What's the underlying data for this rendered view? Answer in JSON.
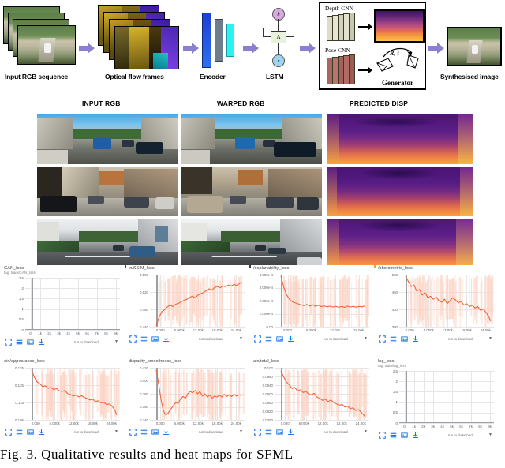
{
  "figure": {
    "caption": "Fig. 3.  Qualitative results and heat maps for SFML"
  },
  "architecture": {
    "stages": [
      {
        "id": "input-rgb",
        "label": "Input RGB sequence"
      },
      {
        "id": "optical-flow",
        "label": "Optical flow frames"
      },
      {
        "id": "encoder",
        "label": "Encoder"
      },
      {
        "id": "lstm",
        "label": "LSTM"
      },
      {
        "id": "synthesised",
        "label": "Synthesised image"
      }
    ],
    "lstm_nodes": {
      "hidden": "h",
      "cell": "A",
      "input": "x"
    },
    "generator_panel": {
      "depth_cnn_label": "Depth CNN",
      "pose_cnn_label": "Pose CNN",
      "transform_label": "R, t",
      "generator_label": "Generator"
    }
  },
  "grid": {
    "columns": [
      "INPUT RGB",
      "WARPED RGB",
      "PREDICTED DISP"
    ],
    "rows": 3
  },
  "tensorboard": {
    "accent_line": "#f4633a",
    "accent_band": "#fbd5c6",
    "icon_color": "#1a73e8",
    "download_label": "run to download",
    "toolbar_icons": [
      "fullscreen-icon",
      "lines-icon",
      "fit-icon",
      "download-icon"
    ],
    "charts": [
      {
        "id": "gan-loss",
        "title": "GAN_loss",
        "tag": "tag: train/GAN_loss",
        "yticks": [
          "0",
          "0.5",
          "1",
          "1.5",
          "2",
          "2.5"
        ],
        "xticks": [
          "0",
          "1k",
          "2k",
          "3k",
          "4k",
          "5k",
          "6k",
          "7k",
          "8k",
          "9k"
        ],
        "empty": true
      },
      {
        "id": "ssim-loss",
        "title": "in/SSIM_loss",
        "tag": "",
        "yticks": [
          "0.440",
          "0.480",
          "0.520",
          "0.560"
        ],
        "xticks": [
          "0.000",
          "6.000k",
          "12.00k",
          "18.00k",
          "24.00k"
        ],
        "empty": false
      },
      {
        "id": "explanability-loss",
        "title": "/explanability_loss",
        "tag": "",
        "yticks": [
          "0.00",
          "1.000e-4",
          "2.000e-4",
          "3.000e-4",
          "4.000e-4"
        ],
        "xticks": [
          "0.000",
          "6.000k",
          "12.00k",
          "18.00k"
        ],
        "empty": false
      },
      {
        "id": "photometric-loss",
        "title": "/photometric_loss",
        "tag": "",
        "yticks": [
          "380",
          "420",
          "460",
          "500"
        ],
        "xticks": [
          "0.000",
          "6.000k",
          "12.00k",
          "18.00k",
          "24.00k"
        ],
        "empty": false
      },
      {
        "id": "appearance-loss",
        "title": "ain/appearance_loss",
        "tag": "",
        "yticks": [
          "0.105",
          "0.115",
          "0.125",
          "0.135"
        ],
        "xticks": [
          "0.000",
          "6.000k",
          "12.00k",
          "18.00k",
          "24.00k"
        ],
        "empty": false
      },
      {
        "id": "disparity-smoothness-loss",
        "title": "disparity_smoothness_loss",
        "tag": "",
        "yticks": [
          "0.340",
          "0.360",
          "0.380",
          "0.400",
          "0.420"
        ],
        "xticks": [
          "0.000",
          "6.000k",
          "12.00k",
          "18.00k",
          "24.00k"
        ],
        "empty": false
      },
      {
        "id": "total-loss",
        "title": "ain/total_loss",
        "tag": "",
        "yticks": [
          "0.0780",
          "0.0820",
          "0.0860",
          "0.0900",
          "0.0940",
          "0.0980",
          "0.102"
        ],
        "xticks": [
          "0.000",
          "6.000k",
          "12.00k",
          "18.00k",
          "24.00k"
        ],
        "empty": false
      },
      {
        "id": "lng-loss",
        "title": "lng_loss",
        "tag": "tag: train/lng_loss",
        "yticks": [
          "0",
          "0.5",
          "1",
          "1.5",
          "2",
          "2.5"
        ],
        "xticks": [
          "0",
          "1k",
          "2k",
          "3k",
          "4k",
          "5k",
          "6k",
          "7k",
          "8k",
          "9k"
        ],
        "empty": true
      }
    ]
  },
  "chart_data": [
    {
      "type": "line",
      "id": "gan-loss",
      "title": "GAN_loss",
      "subtitle": "tag: train/GAN_loss",
      "xlabel": "",
      "ylabel": "",
      "ylim": [
        0,
        2.8
      ],
      "xlim": [
        0,
        9500
      ],
      "grid": true,
      "legend": "none",
      "series": [
        {
          "name": "train/GAN_loss",
          "x": [],
          "values": []
        }
      ],
      "note": "flat at 0 / no data drawn"
    },
    {
      "type": "line",
      "id": "ssim-loss",
      "title": "in/SSIM_loss",
      "xlabel": "",
      "ylabel": "",
      "ylim": [
        0.425,
        0.575
      ],
      "xlim": [
        0,
        25000
      ],
      "grid": true,
      "legend": "none",
      "series": [
        {
          "name": "train/SSIM_loss",
          "x": [
            0,
            800,
            1600,
            2400,
            3200,
            4000,
            4800,
            5600,
            6400,
            7200,
            8000,
            8800,
            9600,
            10400,
            11200,
            12000,
            12800,
            13600,
            14400,
            15200,
            16000,
            16800,
            17600,
            18400,
            19200,
            20000,
            20800,
            21600,
            22400,
            23200,
            24000,
            24600
          ],
          "values": [
            0.428,
            0.452,
            0.468,
            0.474,
            0.482,
            0.487,
            0.483,
            0.49,
            0.492,
            0.497,
            0.501,
            0.504,
            0.509,
            0.513,
            0.508,
            0.516,
            0.52,
            0.523,
            0.529,
            0.534,
            0.53,
            0.538,
            0.541,
            0.537,
            0.543,
            0.54,
            0.545,
            0.542,
            0.547,
            0.544,
            0.549,
            0.554
          ]
        }
      ],
      "band": "shaded variance band, same colour, light"
    },
    {
      "type": "line",
      "id": "explanability-loss",
      "title": "/explanability_loss",
      "xlabel": "",
      "ylabel": "",
      "ylim": [
        0,
        0.00045
      ],
      "xlim": [
        0,
        21000
      ],
      "grid": true,
      "legend": "none",
      "series": [
        {
          "name": "train/explanability_loss",
          "x": [
            0,
            700,
            1400,
            2100,
            2800,
            3500,
            4200,
            4900,
            5600,
            6300,
            7000,
            7700,
            8400,
            9100,
            9800,
            10500,
            11200,
            11900,
            12600,
            13300,
            14000,
            14700,
            15400,
            16100,
            16800,
            17500,
            18200,
            18900,
            19600,
            20300
          ],
          "values": [
            0.00044,
            0.00034,
            0.000275,
            0.000235,
            0.000215,
            0.000205,
            0.000198,
            0.000188,
            0.000182,
            0.000192,
            0.000178,
            0.00019,
            0.000176,
            0.000186,
            0.000174,
            0.00018,
            0.000172,
            0.000178,
            0.00017,
            0.000176,
            0.000168,
            0.000175,
            0.000167,
            0.000178,
            0.00017,
            0.000176,
            0.000169,
            0.000175,
            0.000172,
            0.00018
          ]
        }
      ]
    },
    {
      "type": "line",
      "id": "photometric-loss",
      "title": "/photometric_loss",
      "xlabel": "",
      "ylabel": "",
      "ylim": [
        370,
        510
      ],
      "xlim": [
        0,
        25000
      ],
      "grid": true,
      "legend": "none",
      "series": [
        {
          "name": "train/photometric_loss",
          "x": [
            0,
            800,
            1600,
            2400,
            3200,
            4000,
            4800,
            5600,
            6400,
            7200,
            8000,
            8800,
            9600,
            10400,
            11200,
            12000,
            12800,
            13600,
            14400,
            15200,
            16000,
            16800,
            17600,
            18400,
            19200,
            20000,
            20800,
            21600,
            22400,
            23200,
            24000,
            24500
          ],
          "values": [
            505,
            492,
            478,
            482,
            466,
            470,
            455,
            462,
            448,
            452,
            444,
            450,
            440,
            436,
            444,
            432,
            440,
            448,
            442,
            434,
            438,
            428,
            432,
            424,
            428,
            420,
            424,
            414,
            418,
            408,
            396,
            385
          ]
        }
      ]
    },
    {
      "type": "line",
      "id": "appearance-loss",
      "title": "ain/appearance_loss",
      "xlabel": "",
      "ylabel": "",
      "ylim": [
        0.1018,
        0.1385
      ],
      "xlim": [
        0,
        25000
      ],
      "grid": true,
      "legend": "none",
      "series": [
        {
          "name": "train/appearance_loss",
          "x": [
            0,
            800,
            1600,
            2400,
            3200,
            4000,
            4800,
            5600,
            6400,
            7200,
            8000,
            8800,
            9600,
            10400,
            11200,
            12000,
            12800,
            13600,
            14400,
            15200,
            16000,
            16800,
            17600,
            18400,
            19200,
            20000,
            20800,
            21600,
            22400,
            23200,
            24000,
            24500
          ],
          "values": [
            0.137,
            0.1318,
            0.1286,
            0.1272,
            0.1252,
            0.1258,
            0.124,
            0.1246,
            0.1232,
            0.1238,
            0.1222,
            0.1218,
            0.1226,
            0.1202,
            0.1196,
            0.1186,
            0.1192,
            0.118,
            0.1188,
            0.1176,
            0.1168,
            0.1158,
            0.1164,
            0.1148,
            0.1152,
            0.1138,
            0.1142,
            0.1126,
            0.113,
            0.1114,
            0.1086,
            0.1052
          ]
        }
      ]
    },
    {
      "type": "line",
      "id": "disparity-smoothness-loss",
      "title": "disparity_smoothness_loss",
      "xlabel": "",
      "ylabel": "",
      "ylim": [
        0.332,
        0.428
      ],
      "xlim": [
        0,
        25000
      ],
      "grid": true,
      "legend": "none",
      "series": [
        {
          "name": "train/disparity_smoothness_loss",
          "x": [
            0,
            700,
            1400,
            2100,
            2800,
            3500,
            4200,
            4900,
            5600,
            6300,
            7000,
            7700,
            8400,
            9100,
            9800,
            10500,
            11200,
            11900,
            12600,
            13300,
            14000,
            14700,
            15400,
            16100,
            16800,
            17500,
            18200,
            18900,
            19600,
            20300,
            21000,
            21700,
            22400,
            23100,
            23800,
            24400
          ],
          "values": [
            0.424,
            0.398,
            0.368,
            0.348,
            0.341,
            0.345,
            0.352,
            0.358,
            0.364,
            0.362,
            0.37,
            0.375,
            0.372,
            0.38,
            0.384,
            0.382,
            0.386,
            0.38,
            0.384,
            0.376,
            0.38,
            0.374,
            0.378,
            0.372,
            0.376,
            0.374,
            0.378,
            0.374,
            0.379,
            0.375,
            0.378,
            0.375,
            0.379,
            0.376,
            0.378,
            0.377
          ]
        }
      ]
    },
    {
      "type": "line",
      "id": "total-loss",
      "title": "ain/total_loss",
      "xlabel": "",
      "ylabel": "",
      "ylim": [
        0.0768,
        0.1035
      ],
      "xlim": [
        0,
        25000
      ],
      "grid": true,
      "legend": "none",
      "series": [
        {
          "name": "train/total_loss",
          "x": [
            0,
            800,
            1600,
            2400,
            3200,
            4000,
            4800,
            5600,
            6400,
            7200,
            8000,
            8800,
            9600,
            10400,
            11200,
            12000,
            12800,
            13600,
            14400,
            15200,
            16000,
            16800,
            17600,
            18400,
            19200,
            20000,
            20800,
            21600,
            22400,
            23200,
            24000,
            24500
          ],
          "values": [
            0.102,
            0.0988,
            0.0962,
            0.0948,
            0.0928,
            0.0934,
            0.0916,
            0.0922,
            0.0908,
            0.0914,
            0.09,
            0.0896,
            0.0904,
            0.0884,
            0.0878,
            0.0868,
            0.0874,
            0.0862,
            0.087,
            0.0858,
            0.085,
            0.0842,
            0.0848,
            0.0834,
            0.0838,
            0.0826,
            0.083,
            0.0816,
            0.082,
            0.0806,
            0.079,
            0.078
          ]
        }
      ]
    },
    {
      "type": "line",
      "id": "lng-loss",
      "title": "lng_loss",
      "subtitle": "tag: train/lng_loss",
      "xlabel": "",
      "ylabel": "",
      "ylim": [
        0,
        2.8
      ],
      "xlim": [
        0,
        9500
      ],
      "grid": true,
      "legend": "none",
      "series": [
        {
          "name": "train/lng_loss",
          "x": [],
          "values": []
        }
      ],
      "note": "flat at 0 / no data drawn"
    }
  ]
}
